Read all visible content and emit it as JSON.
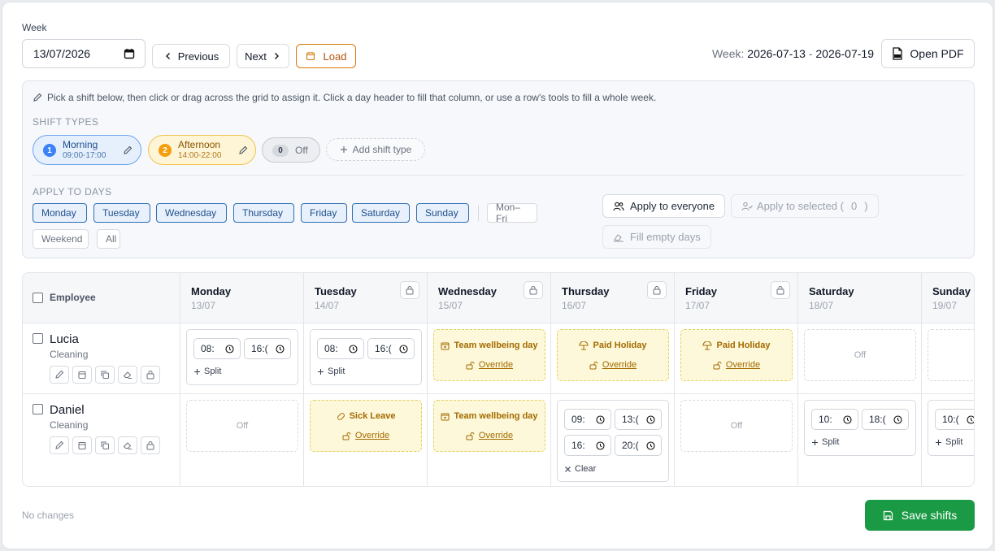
{
  "toolbar": {
    "week_label": "Week",
    "date_value": "13/07/2026",
    "previous_label": "Previous",
    "next_label": "Next",
    "load_label": "Load",
    "week_prefix": "Week:",
    "week_start": "2026-07-13",
    "week_sep": "-",
    "week_end": "2026-07-19",
    "open_pdf_label": "Open PDF"
  },
  "panel": {
    "hint": "Pick a shift below, then click or drag across the grid to assign it. Click a day header to fill that column, or use a row's tools to fill a whole week.",
    "shift_types_title": "SHIFT TYPES",
    "shift_types": [
      {
        "num": "1",
        "name": "Morning",
        "time": "09:00-17:00",
        "color": "#3b82f6"
      },
      {
        "num": "2",
        "name": "Afternoon",
        "time": "14:00-22:00",
        "color": "#f59e0b"
      },
      {
        "num": "0",
        "name": "Off"
      }
    ],
    "add_shift_type": "Add shift type",
    "apply_title": "APPLY TO DAYS",
    "days": [
      "Monday",
      "Tuesday",
      "Wednesday",
      "Thursday",
      "Friday",
      "Saturday",
      "Sunday"
    ],
    "presets": [
      "Mon–Fri",
      "Weekend",
      "All"
    ],
    "apply_everyone": "Apply to everyone",
    "apply_selected": "Apply to selected (",
    "selected_count": "0",
    "apply_selected_close": ")",
    "fill_empty": "Fill empty days"
  },
  "grid": {
    "employee_header": "Employee",
    "columns": [
      {
        "day": "Monday",
        "date": "13/07"
      },
      {
        "day": "Tuesday",
        "date": "14/07"
      },
      {
        "day": "Wednesday",
        "date": "15/07"
      },
      {
        "day": "Thursday",
        "date": "16/07"
      },
      {
        "day": "Friday",
        "date": "17/07"
      },
      {
        "day": "Saturday",
        "date": "18/07"
      },
      {
        "day": "Sunday",
        "date": "19/07"
      }
    ],
    "employees": [
      {
        "name": "Lucia",
        "role": "Cleaning",
        "mon": {
          "start": "08:",
          "end": "16:("
        },
        "tue": {
          "start": "08:",
          "end": "16:("
        },
        "wed": {
          "leave": "Team wellbeing day"
        },
        "thu": {
          "leave": "Paid Holiday"
        },
        "fri": {
          "leave": "Paid Holiday"
        },
        "sat": {
          "off": "Off"
        }
      },
      {
        "name": "Daniel",
        "role": "Cleaning",
        "mon": {
          "off": "Off"
        },
        "tue": {
          "leave": "Sick Leave"
        },
        "wed": {
          "leave": "Team wellbeing day"
        },
        "thu": {
          "s1_start": "09:",
          "s1_end": "13:(",
          "s2_start": "16:",
          "s2_end": "20:("
        },
        "fri": {
          "off": "Off"
        },
        "sat": {
          "start": "10:",
          "end": "18:("
        },
        "sun": {
          "start": "10:("
        }
      }
    ],
    "split_label": "Split",
    "override_label": "Override",
    "clear_label": "Clear"
  },
  "footer": {
    "status": "No changes",
    "save_label": "Save shifts"
  }
}
